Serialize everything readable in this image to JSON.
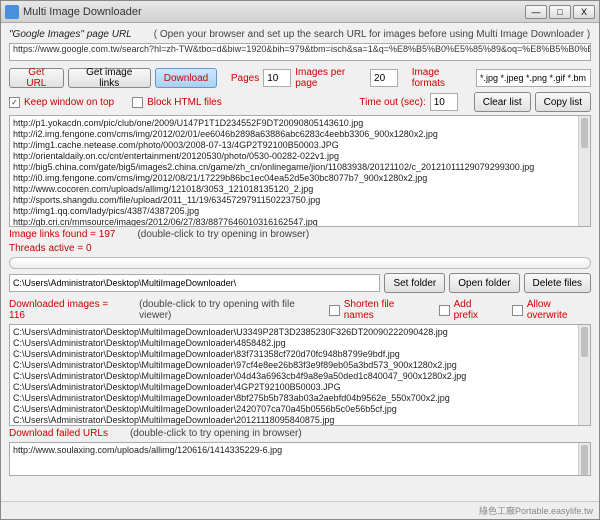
{
  "window": {
    "title": "Multi Image Downloader"
  },
  "header": {
    "url_label": "\"Google Images\" page URL",
    "url_hint": "( Open your browser and  set up the search URL for images before using Multi Image Downloader )",
    "url_value": "https://www.google.com.tw/search?hl=zh-TW&tbo=d&biw=1920&bih=979&tbm=isch&sa=1&q=%E8%B5%B0%E5%85%89&oq=%E8%B5%B0%E5%85"
  },
  "toolbar": {
    "get_url": "Get URL",
    "get_links": "Get image links",
    "download": "Download",
    "pages_lbl": "Pages",
    "pages_val": "10",
    "ipp_lbl": "Images per page",
    "ipp_val": "20",
    "fmt_lbl": "Image formats",
    "fmt_val": "*.jpg *.jpeg *.png *.gif *.bm"
  },
  "opts": {
    "keep_top": "Keep window on top",
    "block_html": "Block HTML files",
    "timeout_lbl": "Time out (sec):",
    "timeout_val": "10",
    "clear": "Clear list",
    "copy": "Copy list"
  },
  "links": {
    "items": [
      "http://p1.yokacdn.com/pic/club/one/2009/U147P1T1D234552F9DT20090805143610.jpg",
      "http://i2.img.fengone.com/cms/img/2012/02/01/ee6046b2898a63886abc6283c4eebb3306_900x1280x2.jpg",
      "http://img1.cache.netease.com/photo/0003/2008-07-13/4GP2T92100B50003.JPG",
      "http://orientaldaily.on.cc/cnt/entertainment/20120530/photo/0530-00282-022v1.jpg",
      "http://big5.china.com/gate/big5/images2.china.cn/game/zh_cn/onlinegame/jion/11083938/20121102/c_20121011129079299300.jpg",
      "http://i0.img.fengone.com/cms/img/2012/08/21/17229b86bc1ec04ea52d5e30bc8077b7_900x1280x2.jpg",
      "http://www.cocoren.com/uploads/allimg/121018/3053_121018135120_2.jpg",
      "http://sports.shangdu.com/file/upload/2011_11/19/6345729791150223750.jpg",
      "http://img1.qq.com/lady/pics/4387/4387205.jpg",
      "http://gb.cri.cn/mmsource/images/2012/06/27/83/8877646010316162547.jpg"
    ],
    "found_lbl": "Image links found = 197",
    "hint": "(double-click to try opening in browser)"
  },
  "threads": {
    "lbl": "Threads active = 0"
  },
  "folder": {
    "value": "C:\\Users\\Administrator\\Desktop\\MultiImageDownloader\\",
    "set": "Set folder",
    "open": "Open folder",
    "del": "Delete files"
  },
  "downloaded": {
    "lbl": "Downloaded images = 116",
    "hint": "(double-click to try opening with file viewer)",
    "shorten": "Shorten file names",
    "prefix": "Add prefix",
    "overwrite": "Allow overwrite",
    "items": [
      "C:\\Users\\Administrator\\Desktop\\MultiImageDownloader\\U3349P28T3D2385230F326DT20090222090428.jpg",
      "C:\\Users\\Administrator\\Desktop\\MultiImageDownloader\\4858482.jpg",
      "C:\\Users\\Administrator\\Desktop\\MultiImageDownloader\\83f731358cf720d70fc948b8799e9bdf.jpg",
      "C:\\Users\\Administrator\\Desktop\\MultiImageDownloader\\97cf4e8ee26b83f3e9f89eb05a3bd573_900x1280x2.jpg",
      "C:\\Users\\Administrator\\Desktop\\MultiImageDownloader\\04d43a6963cb4f9a8e9a50ded1c840047_900x1280x2.jpg",
      "C:\\Users\\Administrator\\Desktop\\MultiImageDownloader\\4GP2T92100B50003.JPG",
      "C:\\Users\\Administrator\\Desktop\\MultiImageDownloader\\8bf275b5b783ab03a2aebfd04b9562e_550x700x2.jpg",
      "C:\\Users\\Administrator\\Desktop\\MultiImageDownloader\\2420707ca70a45b0556b5c0e56b5cf.jpg",
      "C:\\Users\\Administrator\\Desktop\\MultiImageDownloader\\20121118095840875.jpg"
    ]
  },
  "failed": {
    "lbl": "Download failed URLs",
    "hint": "(double-click to try opening in browser)",
    "items": [
      "http://www.soulaxing.com/uploads/allimg/120616/1414335229-6.jpg"
    ]
  },
  "footer": {
    "credit": "綠色工廠Portable.easylife.tw"
  }
}
